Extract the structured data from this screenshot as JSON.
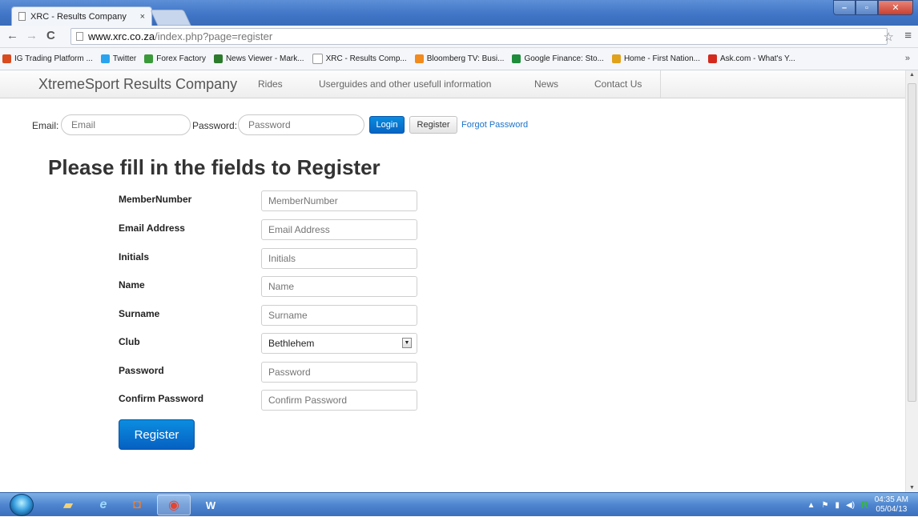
{
  "browser": {
    "tab_title": "XRC - Results Company",
    "tab_close": "×",
    "url_host": "www.xrc.co.za",
    "url_path": "/index.php?page=register",
    "bookmarks": [
      {
        "label": "IG Trading Platform ...",
        "icon_color": "#d94a1e",
        "icon": "ig-icon"
      },
      {
        "label": "Twitter",
        "icon_color": "#2aa3ef",
        "icon": "twitter-icon"
      },
      {
        "label": "Forex Factory",
        "icon_color": "#3a9a3a",
        "icon": "forex-factory-icon"
      },
      {
        "label": "News Viewer - Mark...",
        "icon_color": "#2c7a2c",
        "icon": "news-viewer-icon"
      },
      {
        "label": "XRC - Results Comp...",
        "icon_color": "#ffffff",
        "icon": "page-icon"
      },
      {
        "label": "Bloomberg TV: Busi...",
        "icon_color": "#f28a1c",
        "icon": "bloomberg-icon"
      },
      {
        "label": "Google Finance: Sto...",
        "icon_color": "#1e8c3a",
        "icon": "google-finance-icon"
      },
      {
        "label": "Home - First Nation...",
        "icon_color": "#e0a21a",
        "icon": "fnb-icon"
      },
      {
        "label": "Ask.com - What's Y...",
        "icon_color": "#d42a1e",
        "icon": "ask-icon"
      }
    ],
    "bookmarks_more": "»"
  },
  "site": {
    "brand": "XtremeSport Results Company",
    "nav": [
      "Rides",
      "Userguides and other usefull information",
      "News",
      "Contact Us"
    ]
  },
  "login": {
    "email_label": "Email:",
    "email_placeholder": "Email",
    "password_label": "Password:",
    "password_placeholder": "Password",
    "login_button": "Login",
    "register_button": "Register",
    "forgot_link": "Forgot Password"
  },
  "register": {
    "heading": "Please fill in the fields to Register",
    "fields": [
      {
        "label": "MemberNumber",
        "placeholder": "MemberNumber"
      },
      {
        "label": "Email Address",
        "placeholder": "Email Address"
      },
      {
        "label": "Initials",
        "placeholder": "Initials"
      },
      {
        "label": "Name",
        "placeholder": "Name"
      },
      {
        "label": "Surname",
        "placeholder": "Surname"
      },
      {
        "label": "Club",
        "value": "Bethlehem"
      },
      {
        "label": "Password",
        "placeholder": "Password"
      },
      {
        "label": "Confirm Password",
        "placeholder": "Confirm Password"
      }
    ],
    "submit_label": "Register"
  },
  "taskbar": {
    "time": "04:35 AM",
    "date": "05/04/13"
  },
  "colors": {
    "primary_button": "#0664c4",
    "link": "#1a73c9",
    "title_bar": "#3f74c6"
  }
}
